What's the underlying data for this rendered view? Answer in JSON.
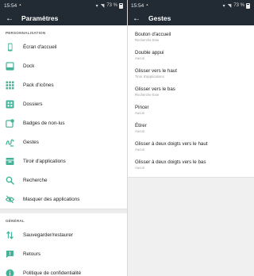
{
  "colors": {
    "toolbar": "#222a33",
    "icon_accent": "#45b29a",
    "background": "#ffffff"
  },
  "left": {
    "status": {
      "time": "15:54",
      "battery": "73 %"
    },
    "title": "Paramètres",
    "sections": [
      {
        "header": "PERSONNALISATION",
        "items": [
          {
            "label": "Écran d'accueil",
            "icon": "phone-icon"
          },
          {
            "label": "Dock",
            "icon": "dock-icon"
          },
          {
            "label": "Pack d'icônes",
            "icon": "icon-pack-icon"
          },
          {
            "label": "Dossiers",
            "icon": "folders-icon"
          },
          {
            "label": "Badges de non-lus",
            "icon": "badge-icon"
          },
          {
            "label": "Gestes",
            "icon": "gesture-icon"
          },
          {
            "label": "Tiroir d'applications",
            "icon": "app-drawer-icon"
          },
          {
            "label": "Recherche",
            "icon": "search-icon"
          },
          {
            "label": "Masquer des applications",
            "icon": "hide-icon"
          }
        ]
      },
      {
        "header": "GÉNÉRAL",
        "items": [
          {
            "label": "Sauvegarder/restaurer",
            "icon": "backup-restore-icon"
          },
          {
            "label": "Retours",
            "icon": "feedback-icon"
          },
          {
            "label": "Politique de confidentialité",
            "icon": "info-icon"
          }
        ]
      }
    ]
  },
  "right": {
    "status": {
      "time": "15:54",
      "battery": "73 %"
    },
    "title": "Gestes",
    "items": [
      {
        "title": "Bouton d'accueil",
        "subtitle": "Recherche Evie"
      },
      {
        "title": "Double appui",
        "subtitle": "Aucun"
      },
      {
        "title": "Glisser vers le haut",
        "subtitle": "Tiroir d'applications"
      },
      {
        "title": "Glisser vers le bas",
        "subtitle": "Recherche Evie"
      },
      {
        "title": "Pincer",
        "subtitle": "Aucun"
      },
      {
        "title": "Étirer",
        "subtitle": "Aucun"
      },
      {
        "title": "Glisser à deux doigts vers le haut",
        "subtitle": "Aucun"
      },
      {
        "title": "Glisser à deux doigts vers le bas",
        "subtitle": "Aucun"
      }
    ]
  }
}
